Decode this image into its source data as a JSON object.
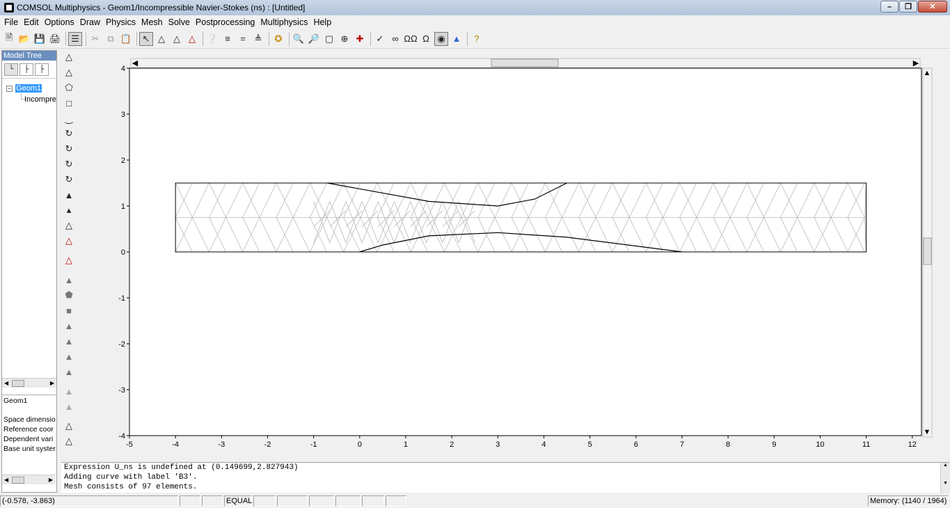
{
  "window": {
    "title": "COMSOL Multiphysics - Geom1/Incompressible Navier-Stokes (ns) : [Untitled]",
    "minimize_icon": "minimize-icon",
    "maximize_icon": "maximize-icon",
    "close_icon": "close-icon"
  },
  "menu": [
    "File",
    "Edit",
    "Options",
    "Draw",
    "Physics",
    "Mesh",
    "Solve",
    "Postprocessing",
    "Multiphysics",
    "Help"
  ],
  "model_tree": {
    "header": "Model Tree",
    "root": "Geom1",
    "child": "Incompre",
    "view_tabs": [
      "model-tree-view-icon",
      "detail-view-icon",
      "physics-view-icon"
    ]
  },
  "properties": {
    "title": "Geom1",
    "rows": [
      "Space dimensio",
      "Reference coor",
      "Dependent vari",
      "Base unit syster"
    ]
  },
  "plot": {
    "x_ticks": [
      "-5",
      "-4",
      "-3",
      "-2",
      "-1",
      "0",
      "1",
      "2",
      "3",
      "4",
      "5",
      "6",
      "7",
      "8",
      "9",
      "10",
      "11",
      "12"
    ],
    "y_ticks": [
      "4",
      "3",
      "2",
      "1",
      "0",
      "-1",
      "-2",
      "-3",
      "-4"
    ],
    "xlim": [
      -5,
      12.2
    ],
    "ylim": [
      -4,
      4
    ],
    "domain": {
      "x0": -4,
      "x1": 11,
      "y0": 0,
      "y1": 1.5
    },
    "top_bump": [
      [
        -0.7,
        1.5
      ],
      [
        1.5,
        1.1
      ],
      [
        3.0,
        1.0
      ],
      [
        3.8,
        1.15
      ],
      [
        4.5,
        1.5
      ]
    ],
    "bottom_bump": [
      [
        0,
        0
      ],
      [
        0.5,
        0.15
      ],
      [
        1.5,
        0.35
      ],
      [
        3.0,
        0.42
      ],
      [
        4.5,
        0.32
      ],
      [
        7,
        0
      ]
    ],
    "mesh_color": "#b8b8b8",
    "edge_color": "#000000"
  },
  "log": [
    "Expression U_ns is undefined at (0.149699,2.827943)",
    "Adding curve with label 'B3'.",
    "Mesh consists of 97 elements."
  ],
  "status": {
    "coords": "(-0.578, -3.863)",
    "equal": "EQUAL",
    "memory": "Memory: (1140 / 1964)"
  }
}
